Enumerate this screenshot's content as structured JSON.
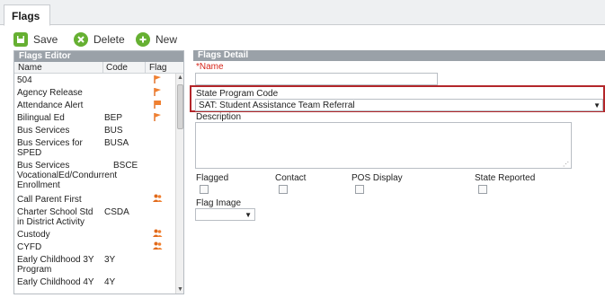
{
  "tab": {
    "label": "Flags"
  },
  "toolbar": {
    "save_label": "Save",
    "delete_label": "Delete",
    "new_label": "New"
  },
  "editor": {
    "title": "Flags Editor",
    "columns": {
      "name": "Name",
      "code": "Code",
      "flag": "Flag"
    },
    "rows": [
      {
        "name": "504",
        "code": "",
        "flag": "flag-icon"
      },
      {
        "name": "Agency Release",
        "code": "",
        "flag": "flag-icon"
      },
      {
        "name": "Attendance Alert",
        "code": "",
        "flag": "flag-icon"
      },
      {
        "name": "Bilingual Ed",
        "code": "BEP",
        "flag": "flag-icon"
      },
      {
        "name": "Bus Services",
        "code": "BUS",
        "flag": ""
      },
      {
        "name": "Bus Services for SPED",
        "code": "BUSA",
        "flag": ""
      },
      {
        "name": "Bus Services VocationalEd/Condurrent Enrollment",
        "code": "BSCE",
        "flag": ""
      },
      {
        "name": "Call Parent First",
        "code": "",
        "flag": "people-icon"
      },
      {
        "name": "Charter School Std in District Activity",
        "code": "CSDA",
        "flag": ""
      },
      {
        "name": "Custody",
        "code": "",
        "flag": "people-icon"
      },
      {
        "name": "CYFD",
        "code": "",
        "flag": "people-icon"
      },
      {
        "name": "Early Childhood 3Y Program",
        "code": "3Y",
        "flag": ""
      },
      {
        "name": "Early Childhood 4Y",
        "code": "4Y",
        "flag": ""
      }
    ]
  },
  "detail": {
    "title": "Flags Detail",
    "name_label": "*Name",
    "name_value": "",
    "state_program_code_label": "State Program Code",
    "state_program_code_value": "SAT: Student Assistance Team Referral",
    "description_label": "Description",
    "description_value": "",
    "flagged_label": "Flagged",
    "contact_label": "Contact",
    "pos_display_label": "POS Display",
    "state_reported_label": "State Reported",
    "flag_image_label": "Flag Image",
    "flag_image_value": ""
  },
  "colors": {
    "accent_green": "#66b032",
    "header_gray": "#9aa1a8",
    "highlight_red": "#b3262a",
    "flag_orange": "#f08030"
  }
}
